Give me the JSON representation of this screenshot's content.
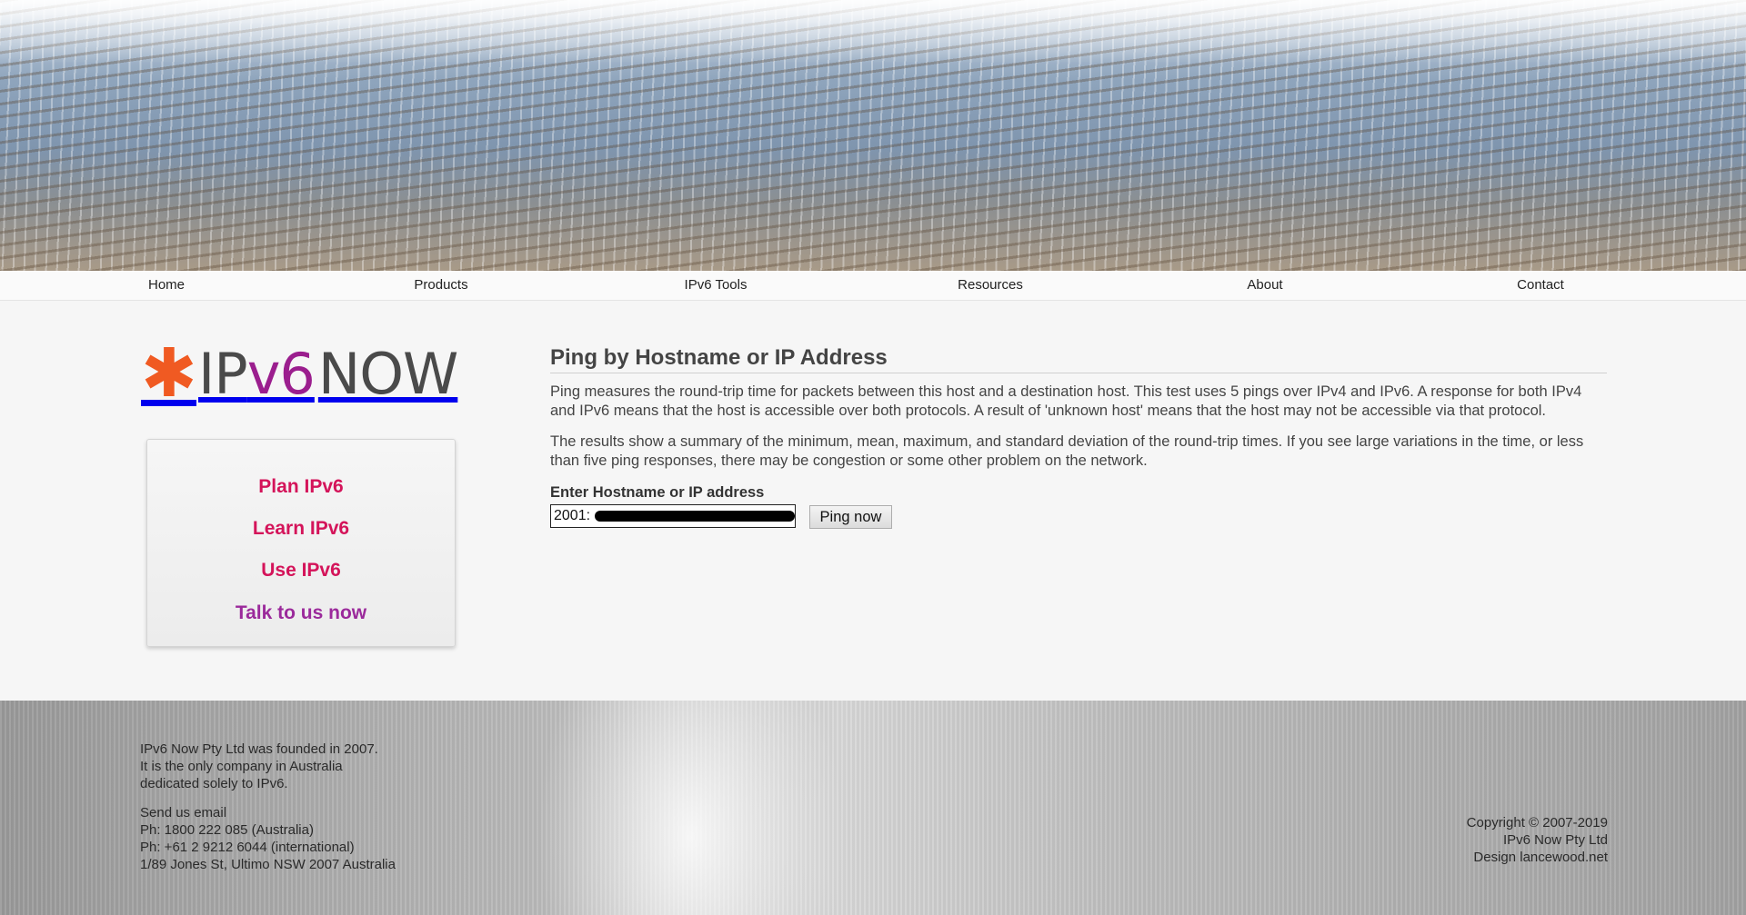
{
  "nav": {
    "items": [
      "Home",
      "Products",
      "IPv6 Tools",
      "Resources",
      "About",
      "Contact"
    ]
  },
  "logo": {
    "star": "✱",
    "ip": "IP",
    "v6": "v6",
    "now": "NOW"
  },
  "sidebar": {
    "links": [
      {
        "label": "Plan IPv6",
        "color": "#d4145a"
      },
      {
        "label": "Learn IPv6",
        "color": "#d4145a"
      },
      {
        "label": "Use IPv6",
        "color": "#d4145a"
      },
      {
        "label": "Talk to us now",
        "color": "#9b2a9b"
      }
    ]
  },
  "main": {
    "title": "Ping by Hostname or IP Address",
    "para1": "Ping measures the round-trip time for packets between this host and a destination host. This test uses 5 pings over IPv4 and IPv6. A response for both IPv4 and IPv6 means that the host is accessible over both protocols. A result of 'unknown host' means that the host may not be accessible via that protocol.",
    "para2": "The results show a summary of the minimum, mean, maximum, and standard deviation of the round-trip times. If you see large variations in the time, or less than five ping responses, there may be congestion or some other problem on the network.",
    "input_label": "Enter Hostname or IP address",
    "input_value": "2001:",
    "button_label": "Ping now"
  },
  "footer": {
    "about_lines": [
      "IPv6 Now Pty Ltd was founded in 2007.",
      "It is the only company in Australia",
      "dedicated solely to IPv6."
    ],
    "email_link": "Send us email",
    "phone_au": "Ph: 1800 222 085 (Australia)",
    "phone_intl": "Ph: +61 2 9212 6044 (international)",
    "address": "1/89 Jones St, Ultimo NSW 2007 Australia",
    "copyright": "Copyright © 2007-2019",
    "company": "IPv6 Now Pty Ltd",
    "design": "Design lancewood.net"
  }
}
